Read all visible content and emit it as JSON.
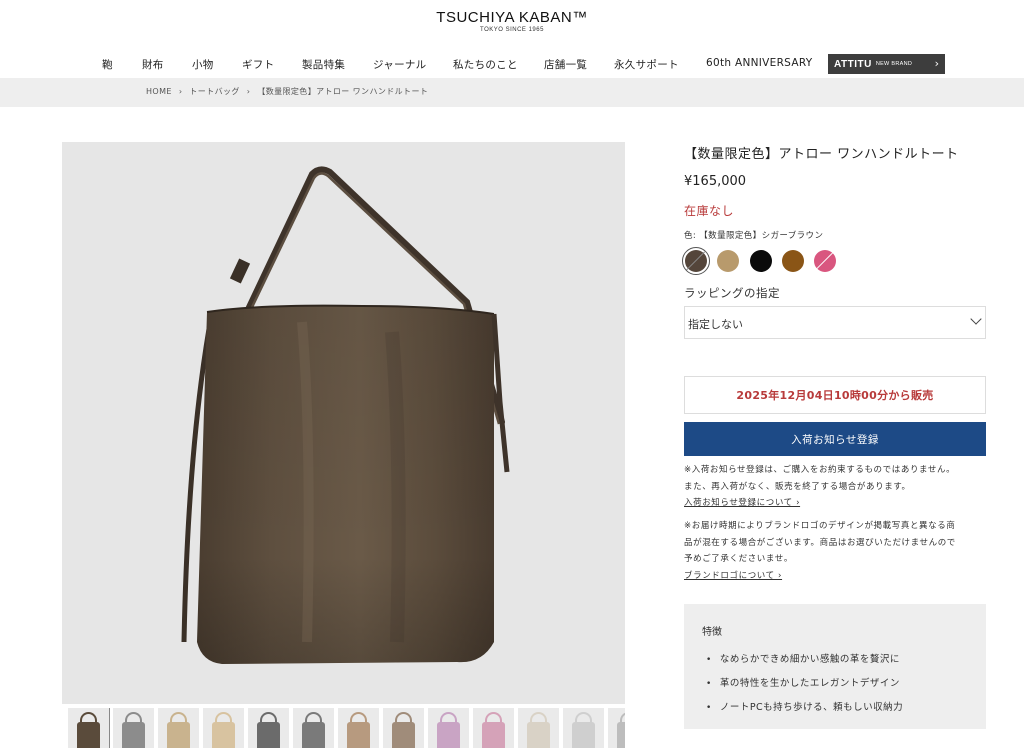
{
  "header": {
    "logo": "TSUCHIYA KABAN™",
    "logo_sub": "TOKYO SINCE 1965"
  },
  "nav": {
    "items": [
      "鞄",
      "財布",
      "小物",
      "ギフト",
      "製品特集",
      "ジャーナル",
      "私たちのこと",
      "店舗一覧",
      "永久サポート",
      "60th ANNIVERSARY"
    ],
    "brand_name": "ATTITU",
    "brand_tag": "NEW BRAND",
    "brand_chevron": "›"
  },
  "breadcrumb": [
    "HOME",
    "›",
    "トートバッグ",
    "›",
    "【数量限定色】アトロー ワンハンドルトート"
  ],
  "product": {
    "title": "【数量限定色】アトロー ワンハンドルトート",
    "price": "¥165,000",
    "stock": "在庫なし",
    "color_label": "色: 【数量限定色】シガーブラウン",
    "swatches": [
      {
        "name": "cigar-brown",
        "color": "#54453a",
        "selected": true,
        "slashed": true
      },
      {
        "name": "beige",
        "color": "#b89a6c",
        "selected": false,
        "slashed": false
      },
      {
        "name": "black",
        "color": "#0a0a0a",
        "selected": false,
        "slashed": false
      },
      {
        "name": "brown",
        "color": "#8a5516",
        "selected": false,
        "slashed": false
      },
      {
        "name": "pink",
        "color": "#d9567f",
        "selected": false,
        "slashed": true
      }
    ],
    "wrapping_label": "ラッピングの指定",
    "wrapping_value": "指定しない",
    "sale_date": "2025年12月04日10時00分から販売",
    "notify_button": "入荷お知らせ登録",
    "note1_line1": "※入荷お知らせ登録は、ご購入をお約束するものではありません。",
    "note1_line2": "また、再入荷がなく、販売を終了する場合があります。",
    "note1_link": "入荷お知らせ登録について ›",
    "note2_line1": "※お届け時期によりブランドロゴのデザインが掲載写真と異なる商",
    "note2_line2": "品が混在する場合がございます。商品はお選びいただけませんので",
    "note2_line3": "予めご了承くださいませ。",
    "note2_link": "ブランドロゴについて ›",
    "features_title": "特徴",
    "features": [
      "なめらかできめ細かい感触の革を贅沢に",
      "革の特性を生かしたエレガントデザイン",
      "ノートPCも持ち歩ける、頼もしい収納力"
    ]
  },
  "colors": {
    "accent_blue": "#1d4a86",
    "alert_red": "#b83a3a",
    "bag_brown": "#5a4b3b"
  },
  "thumbnails": [
    {
      "color": "#5a4b3b",
      "active": true
    },
    {
      "color": "#8c8c8c",
      "active": false
    },
    {
      "color": "#c9b38e",
      "active": false
    },
    {
      "color": "#d8c3a0",
      "active": false
    },
    {
      "color": "#6b6b6b",
      "active": false
    },
    {
      "color": "#7a7a7a",
      "active": false
    },
    {
      "color": "#b79a7f",
      "active": false
    },
    {
      "color": "#a08c7a",
      "active": false
    },
    {
      "color": "#c9a4c4",
      "active": false
    },
    {
      "color": "#d5a2b8",
      "active": false
    },
    {
      "color": "#d9d2c6",
      "active": false
    },
    {
      "color": "#cfcfcf",
      "active": false
    },
    {
      "color": "#bdbdbd",
      "active": false
    }
  ]
}
